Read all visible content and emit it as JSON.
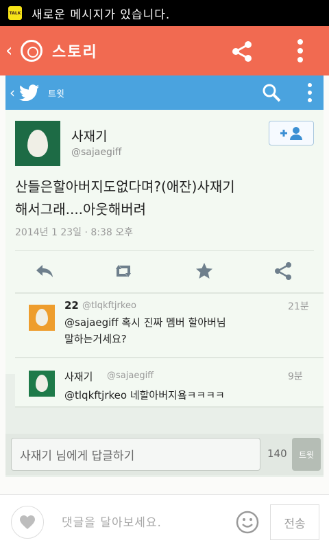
{
  "status_bar": {
    "notification": "새로운 메시지가 있습니다."
  },
  "app_bar": {
    "title": "스토리"
  },
  "twitter": {
    "screen_label": "트윗",
    "tweet": {
      "author_name": "사재기",
      "author_handle": "@sajaegiff",
      "text_line1": "산들은할아버지도없다며?(애잔)사재기",
      "text_line2": "해서그래....아웃해버려",
      "timestamp": "2014년 1 23일 · 8:38 오후"
    },
    "replies": [
      {
        "name": "22",
        "handle": "@tlqkftjrkeo",
        "time": "21분",
        "text_line1": "@sajaegiff 혹시 진짜 멤버 할아버님",
        "text_line2": "말하는거세요?"
      },
      {
        "name": "사재기",
        "handle": "@sajaegiff",
        "time": "9분",
        "text_line1": "@tlqkftjrkeo 네할아버지욬ㅋㅋㅋㅋ"
      }
    ],
    "reply_input_placeholder": "사재기 님에게 답글하기",
    "char_count": "140",
    "reply_button": "트윗"
  },
  "comment_bar": {
    "placeholder": "댓글을 달아보세요.",
    "send_label": "전송"
  },
  "colors": {
    "app_bar": "#f16a51",
    "twitter_blue": "#4aa3df",
    "follow_blue": "#3b8fd3"
  },
  "icons": {
    "notification": "kakaotalk-icon",
    "back": "chevron-left-icon",
    "story": "kakaostory-icon",
    "share": "share-icon",
    "more": "more-vertical-icon",
    "bird": "twitter-bird-icon",
    "search": "search-icon",
    "follow": "add-user-icon",
    "reply": "reply-icon",
    "retweet": "retweet-icon",
    "favorite": "star-icon",
    "heart": "heart-icon",
    "emoji": "smiley-icon"
  }
}
